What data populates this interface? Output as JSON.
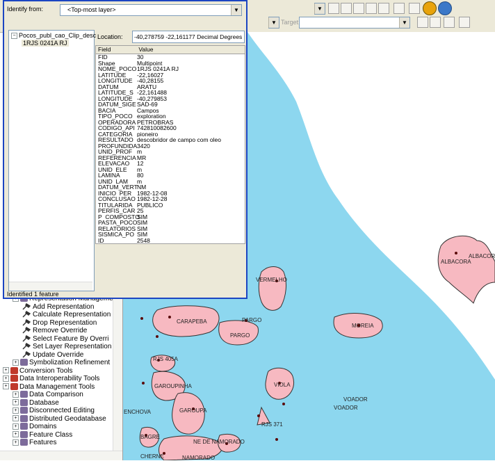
{
  "identify": {
    "identify_from_label": "Identify from:",
    "layer_combo_value": "<Top-most layer>",
    "location_label": "Location:",
    "location_value": "-40,278759  -22,161177 Decimal Degrees",
    "tree_layer": "Pocos_publ_cao_Clip_desc",
    "tree_feature": "1RJS 0241A RJ",
    "column_field": "Field",
    "column_value": "Value",
    "rows": [
      {
        "field": "FID",
        "value": "30"
      },
      {
        "field": "Shape",
        "value": "Multipoint"
      },
      {
        "field": "NOME_POCO",
        "value": "1RJS 0241A RJ"
      },
      {
        "field": "LATITUDE",
        "value": "-22,16027"
      },
      {
        "field": "LONGITUDE",
        "value": "-40,28155"
      },
      {
        "field": "DATUM",
        "value": "ARATU"
      },
      {
        "field": "LATITUDE_S",
        "value": "-22,161488"
      },
      {
        "field": "LONGITUDE_",
        "value": "-40,279853"
      },
      {
        "field": "DATUM_SIGE",
        "value": "SAD-69"
      },
      {
        "field": "BACIA",
        "value": "Campos"
      },
      {
        "field": "TIPO_POCO",
        "value": "exploration"
      },
      {
        "field": "OPERADORA",
        "value": "PETROBRAS"
      },
      {
        "field": "CODIGO_API",
        "value": "742810082600"
      },
      {
        "field": "CATEGORIA",
        "value": "pioneiro"
      },
      {
        "field": "RESULTADO",
        "value": "descobridor de campo com oleo"
      },
      {
        "field": "PROFUNDIDA",
        "value": "3420"
      },
      {
        "field": "UNID_PROF",
        "value": "m"
      },
      {
        "field": "REFERENCIA",
        "value": "MR"
      },
      {
        "field": "ELEVACAO",
        "value": "12"
      },
      {
        "field": "UNID_ELE",
        "value": "m"
      },
      {
        "field": "LAMINA",
        "value": "80"
      },
      {
        "field": "UNID_LAM",
        "value": "m"
      },
      {
        "field": "DATUM_VERT",
        "value": "NM"
      },
      {
        "field": "INICIO_PER",
        "value": "1982-12-08"
      },
      {
        "field": "CONCLUSAO",
        "value": "1982-12-28"
      },
      {
        "field": "TITULARIDA",
        "value": "PUBLICO"
      },
      {
        "field": "PERFIS_CAR",
        "value": "25"
      },
      {
        "field": "P_COMPOSTO",
        "value": "SIM"
      },
      {
        "field": "PASTA_POCO",
        "value": "SIM"
      },
      {
        "field": "RELATORIOS",
        "value": "SIM"
      },
      {
        "field": "SISMICA_PO",
        "value": "SIM"
      },
      {
        "field": "ID_",
        "value": "2548"
      }
    ],
    "status": "Identified 1 feature"
  },
  "toolbar": {
    "target_label": "Target:"
  },
  "toolbox": {
    "items": [
      {
        "label": "Representation Management",
        "kind": "toolset",
        "indent": 1
      },
      {
        "label": "Add Representation",
        "kind": "tool",
        "indent": 2
      },
      {
        "label": "Calculate Representation",
        "kind": "tool",
        "indent": 2
      },
      {
        "label": "Drop Representation",
        "kind": "tool",
        "indent": 2
      },
      {
        "label": "Remove Override",
        "kind": "tool",
        "indent": 2
      },
      {
        "label": "Select Feature By Overri",
        "kind": "tool",
        "indent": 2
      },
      {
        "label": "Set Layer Representation",
        "kind": "tool",
        "indent": 2
      },
      {
        "label": "Update Override",
        "kind": "tool",
        "indent": 2
      },
      {
        "label": "Symbolization Refinement",
        "kind": "toolset",
        "indent": 1
      },
      {
        "label": "Conversion Tools",
        "kind": "toolbox",
        "indent": 0
      },
      {
        "label": "Data Interoperability Tools",
        "kind": "toolbox",
        "indent": 0
      },
      {
        "label": "Data Management Tools",
        "kind": "toolbox",
        "indent": 0
      },
      {
        "label": "Data Comparison",
        "kind": "toolset",
        "indent": 1
      },
      {
        "label": "Database",
        "kind": "toolset",
        "indent": 1
      },
      {
        "label": "Disconnected Editing",
        "kind": "toolset",
        "indent": 1
      },
      {
        "label": "Distributed Geodatabase",
        "kind": "toolset",
        "indent": 1
      },
      {
        "label": "Domains",
        "kind": "toolset",
        "indent": 1
      },
      {
        "label": "Feature Class",
        "kind": "toolset",
        "indent": 1
      },
      {
        "label": "Features",
        "kind": "toolset",
        "indent": 1
      }
    ]
  },
  "map": {
    "ocean_color": "#8dd7ef",
    "field_color": "#f7b9c1",
    "labels": {
      "albacora": "ALBACORA",
      "albacora2": "ALBACORA",
      "vermelho": "VERMELHO",
      "carapeba": "CARAPEBA",
      "pargo": "PARGO",
      "pargo2": "PARGO",
      "moreia": "MOREIA",
      "rjs405a": "RJS 405A",
      "garoupinha": "GAROUPINHA",
      "viola": "VIOLA",
      "voador": "VOADOR",
      "voador2": "VOADOR",
      "enchova": "ENCHOVA",
      "garoupa": "GAROUPA",
      "rjs371": "RJS 371",
      "bagre": "BAGRE",
      "namorado_oeste": "NE DE NAMORADO",
      "cherne": "CHERNE",
      "namorado": "NAMORADO"
    }
  }
}
